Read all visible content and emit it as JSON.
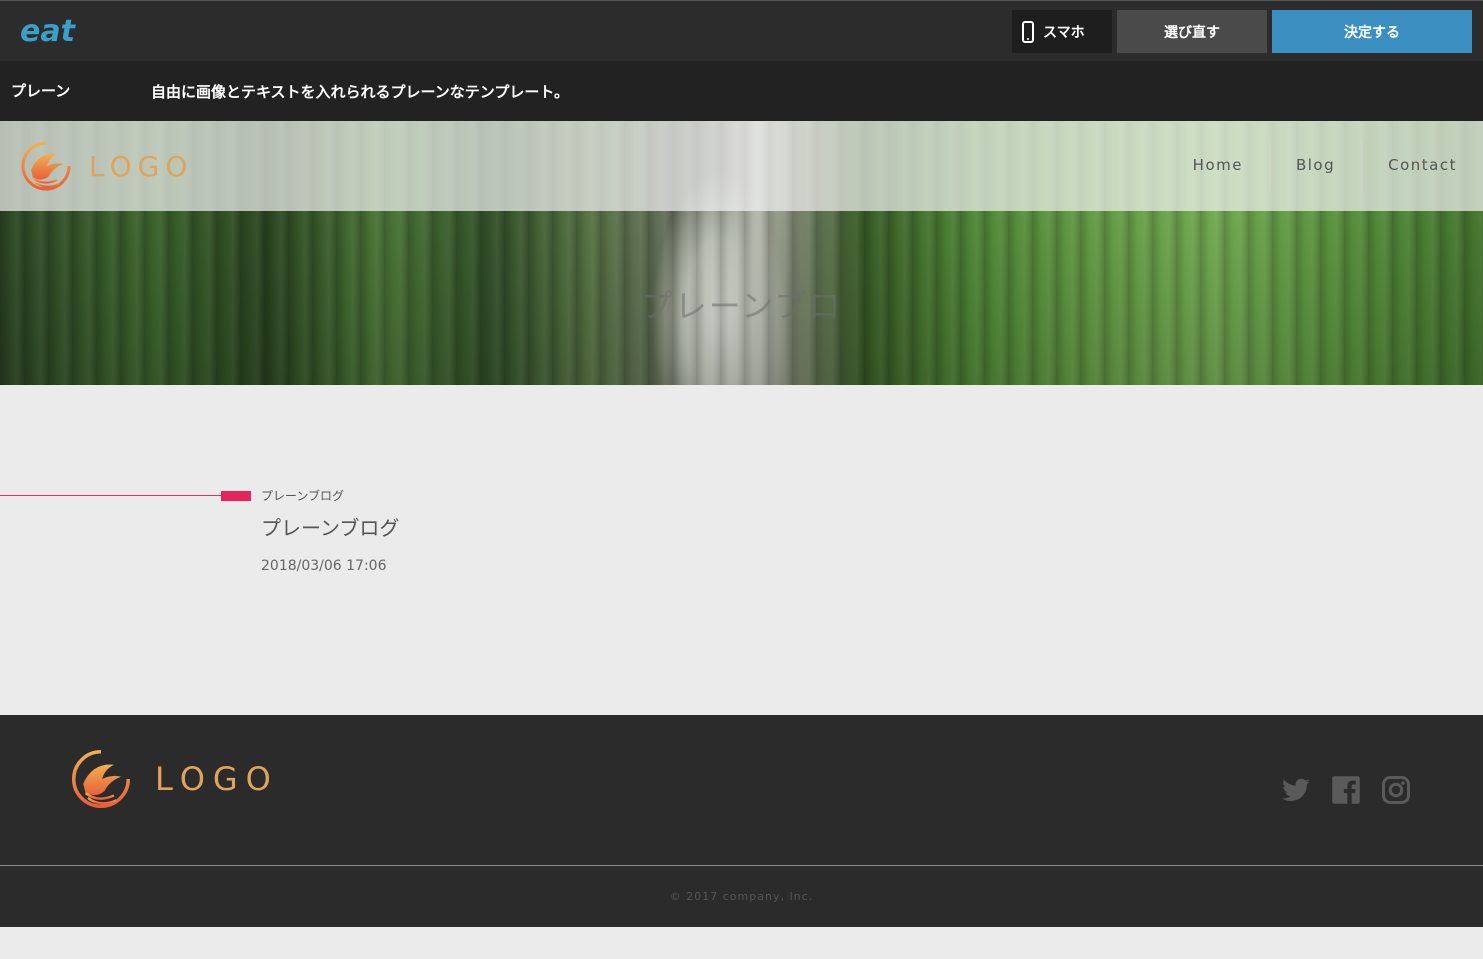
{
  "editor": {
    "brand": "eat",
    "smartphone_label": "スマホ",
    "reselect_label": "選び直す",
    "decide_label": "決定する"
  },
  "template": {
    "name": "プレーン",
    "description": "自由に画像とテキストを入れられるプレーンなテンプレート。"
  },
  "site": {
    "logo_text": "LOGO",
    "nav": [
      "Home",
      "Blog",
      "Contact"
    ],
    "hero_title": "プレーンブロ"
  },
  "post": {
    "category": "プレーンブログ",
    "title": "プレーンブログ",
    "date": "2018/03/06 17:06"
  },
  "footer": {
    "logo_text": "LOGO",
    "social_icons": [
      "twitter-icon",
      "facebook-icon",
      "instagram-icon"
    ],
    "copyright": "© 2017 company, Inc."
  },
  "colors": {
    "topbar": "#2c2c2c",
    "decide_button": "#3a8fc0",
    "accent_pink": "#e8225c",
    "logo_gold": "#e0a35a",
    "footer": "#2b2b2b"
  }
}
